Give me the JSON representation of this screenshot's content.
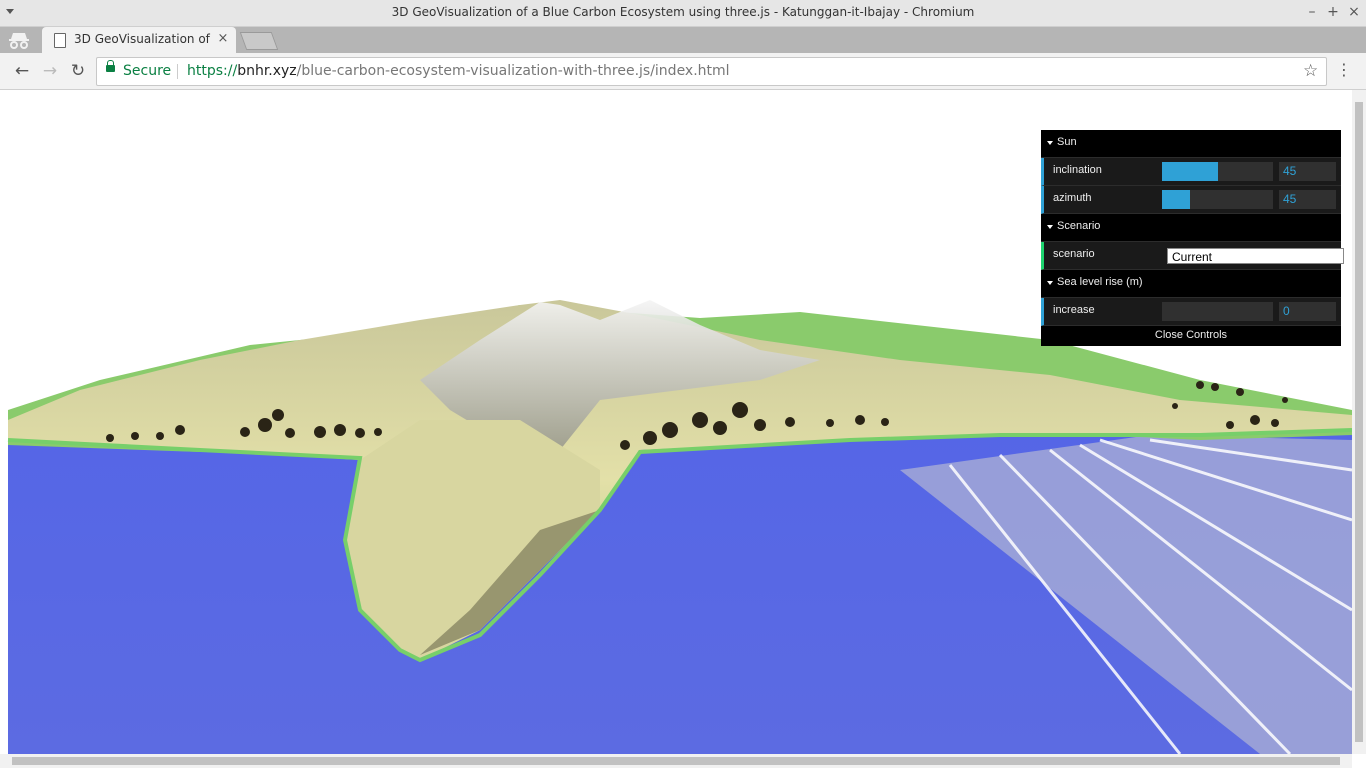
{
  "window": {
    "title": "3D GeoVisualization of a Blue Carbon Ecosystem using three.js - Katunggan-it-Ibajay - Chromium",
    "minimize_label": "–",
    "maximize_label": "+",
    "close_label": "×"
  },
  "tab": {
    "title": "3D GeoVisualization of a",
    "close_label": "×"
  },
  "toolbar": {
    "back_label": "←",
    "forward_label": "→",
    "reload_label": "↻",
    "secure_label": "Secure",
    "url_scheme": "https://",
    "url_host": "bnhr.xyz",
    "url_path": "/blue-carbon-ecosystem-visualization-with-three.js/index.html",
    "star_label": "☆",
    "menu_label": "⋮"
  },
  "gui": {
    "sun": {
      "title": "Sun",
      "inclination": {
        "label": "inclination",
        "value": "45",
        "fraction": 0.5
      },
      "azimuth": {
        "label": "azimuth",
        "value": "45",
        "fraction": 0.25
      }
    },
    "scenario": {
      "title": "Scenario",
      "field": {
        "label": "scenario",
        "value": "Current"
      }
    },
    "sea_level": {
      "title": "Sea level rise (m)",
      "increase": {
        "label": "increase",
        "value": "0",
        "fraction": 0
      }
    },
    "close_label": "Close Controls"
  },
  "colors": {
    "water": "#5a6be8",
    "terrain_green": "#7fc66a",
    "terrain_sand": "#d9d8a0",
    "terrain_peak": "#e8e8e8",
    "gui_accent": "#2fa1d6"
  },
  "icons": {
    "lock": "lock-icon",
    "star": "star-icon",
    "incognito": "incognito-icon",
    "favicon": "page-icon"
  }
}
